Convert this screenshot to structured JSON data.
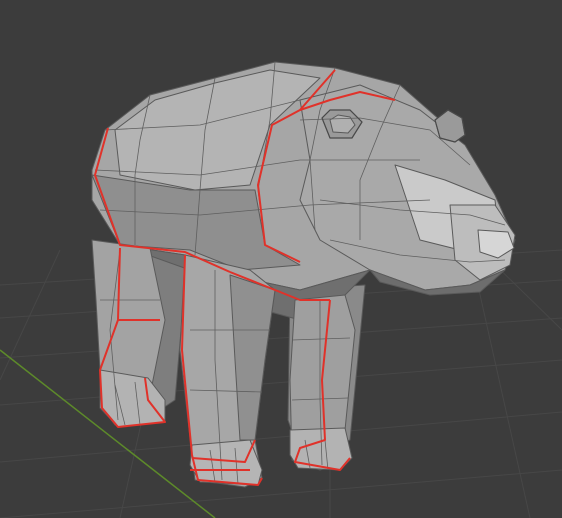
{
  "viewport": {
    "name": "3d-viewport",
    "background": "#3c3c3c",
    "grid_color": "#474747",
    "axis_y_color": "#5d8a2a"
  },
  "model": {
    "name": "bear-mesh",
    "base_color": "#9d9d9d",
    "light_color": "#c9c9c9",
    "dark_color": "#6e6e6e",
    "wire_color": "#5a5a5a",
    "seam_color": "#e0322a"
  }
}
